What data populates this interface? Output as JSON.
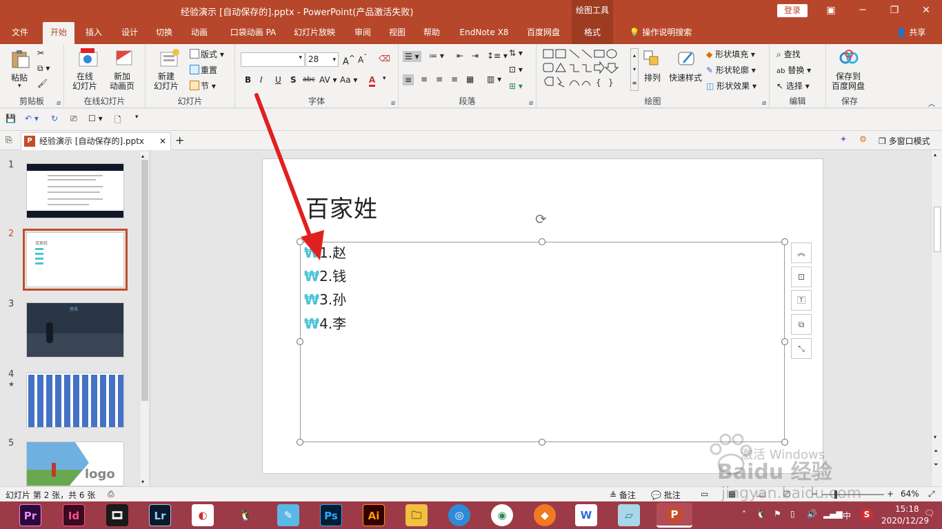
{
  "window": {
    "title": "经验演示 [自动保存的].pptx  -  PowerPoint(产品激活失败)",
    "context_tools": "绘图工具",
    "login": "登录"
  },
  "tabs": [
    "文件",
    "开始",
    "插入",
    "设计",
    "切换",
    "动画",
    "口袋动画 PA",
    "幻灯片放映",
    "审阅",
    "视图",
    "帮助",
    "EndNote X8",
    "百度网盘",
    "格式"
  ],
  "tell_me": "操作说明搜索",
  "share": "共享",
  "ribbon": {
    "clipboard": {
      "label": "剪贴板",
      "paste": "粘贴"
    },
    "online_slides": {
      "label": "在线幻灯片",
      "online": "在线\n幻灯片",
      "add_anim": "新加\n动画页",
      "hot": "HOT"
    },
    "slides": {
      "label": "幻灯片",
      "new_slide": "新建\n幻灯片",
      "layout": "版式",
      "reset": "重置",
      "section": "节"
    },
    "font": {
      "label": "字体",
      "size": "28"
    },
    "paragraph": {
      "label": "段落"
    },
    "drawing": {
      "label": "绘图",
      "arrange": "排列",
      "quick_styles": "快速样式",
      "fill": "形状填充",
      "outline": "形状轮廓",
      "effects": "形状效果"
    },
    "editing": {
      "label": "编辑",
      "find": "查找",
      "replace": "替换",
      "select": "选择"
    },
    "save": {
      "label": "保存",
      "save_to": "保存到\n百度网盘"
    }
  },
  "doc_tab": "经验演示  [自动保存的].pptx",
  "multi_window": "多窗口模式",
  "slides": [
    {
      "num": "1"
    },
    {
      "num": "2",
      "title": "百家姓"
    },
    {
      "num": "3",
      "title": "感悟"
    },
    {
      "num": "4"
    },
    {
      "num": "5",
      "logo": "logo"
    }
  ],
  "slide": {
    "title": "百家姓",
    "bullets": [
      {
        "mark": "₩",
        "text": "1.赵"
      },
      {
        "mark": "₩",
        "text": "2.钱"
      },
      {
        "mark": "₩",
        "text": "3.孙"
      },
      {
        "mark": "₩",
        "text": "4.李"
      }
    ]
  },
  "status": {
    "slide_info": "幻灯片 第 2 张，共 6 张",
    "notes": "备注",
    "comments": "批注",
    "zoom": "64%"
  },
  "watermark": {
    "activate": "激活 Windows",
    "brand": "Baidu 经验",
    "url": "jingyan.baidu.com"
  },
  "taskbar": {
    "apps": [
      "Pr",
      "Id",
      "",
      "Lr",
      "",
      "",
      "",
      "Ps",
      "Ai",
      "",
      "",
      "",
      "",
      "",
      "",
      ""
    ],
    "ime": "中",
    "time": "15:18",
    "date": "2020/12/29"
  },
  "colors": {
    "accent": "#b7472a",
    "bullet": "#4bc3d6",
    "taskbar": "#9c3a48",
    "arrow": "#e02020"
  }
}
